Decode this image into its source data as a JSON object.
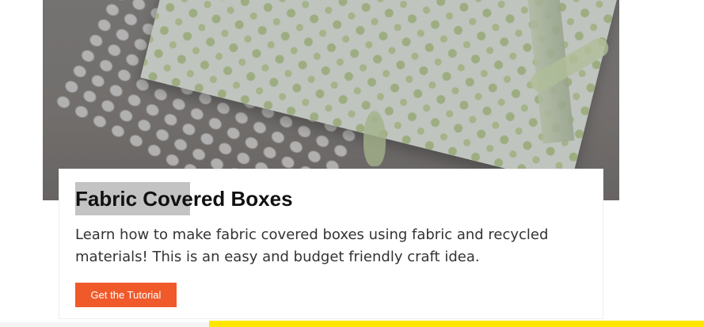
{
  "hero": {
    "image_alt": "Fabric covered box with green patterned fabric"
  },
  "card": {
    "title": "Fabric Covered Boxes",
    "description": "Learn how to make fabric covered boxes using fabric and recycled materials! This is an easy and budget friendly craft idea.",
    "button_label": "Get the Tutorial"
  },
  "colors": {
    "accent": "#f05a2a",
    "footer_accent": "#ffe600",
    "title_highlight": "#c3c3c3"
  }
}
